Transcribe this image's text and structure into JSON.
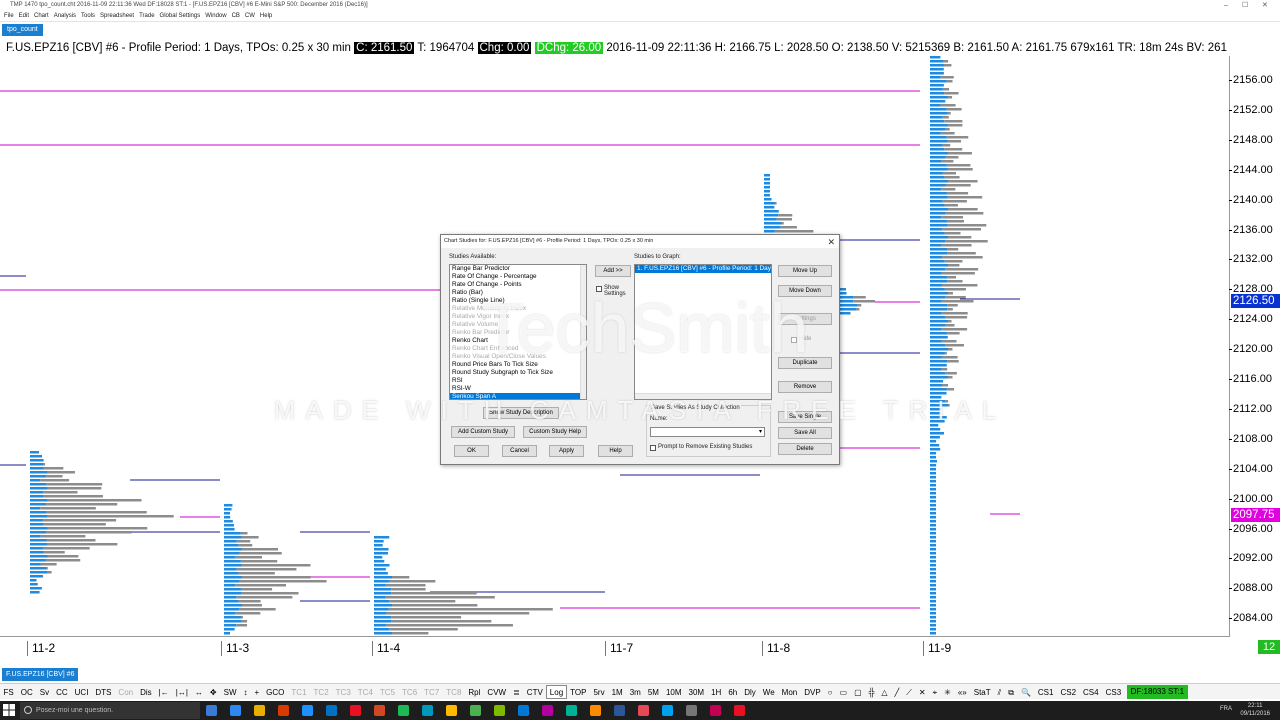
{
  "window": {
    "title": "TMP 1470 tpo_count.cht  2016-11-09  22:11:36 Wed  DF:18028  ST:1 - [F.US.EPZ16 [CBV] #6  E-Mini S&P 500: December 2016 (Dec16)]",
    "controls": [
      "–",
      "☐",
      "✕"
    ]
  },
  "menu": [
    "File",
    "Edit",
    "Chart",
    "Analysis",
    "Tools",
    "Spreadsheet",
    "Trade",
    "Global Settings",
    "Window",
    "CB",
    "CW",
    "Help"
  ],
  "chart_tab": "tpo_count",
  "header": {
    "symbol_text": "F.US.EPZ16 [CBV]  #6  - Profile Period: 1 Days, TPOs: 0.25 x 30 min",
    "close": "C: 2161.50",
    "ticks": " T: 1964704 ",
    "chg": "Chg: 0.00",
    "dchg": "DChg: 26.00",
    "rest": " 2016-11-09 22:11:36  H: 2166.75  L: 2028.50  O: 2138.50  V: 5215369  B: 2161.50  A: 2161.75  679x161  TR: 18m 24s  BV: 261"
  },
  "colors": {
    "tpo_blue": "#1e8ae0",
    "tpo_gray": "#8c8c8c",
    "level_magenta": "#d000d0",
    "level_navy": "#1a1a90",
    "price_label_blue": "#0a32d0",
    "price_label_magenta": "#e000e0"
  },
  "price_axis": {
    "ticks": [
      "2156.00",
      "2152.00",
      "2148.00",
      "2144.00",
      "2140.00",
      "2136.00",
      "2132.00",
      "2128.00",
      "2124.00",
      "2120.00",
      "2116.00",
      "2112.00",
      "2108.00",
      "2104.00",
      "2100.00",
      "2096.00",
      "2092.00",
      "2088.00",
      "2084.00"
    ],
    "current_label": "2126.50",
    "magenta_label": "2097.75"
  },
  "date_axis": [
    "11-2",
    "11-3",
    "11-4",
    "11-7",
    "11-8",
    "11-9"
  ],
  "corner_badge": "12",
  "sheet_tab": "F.US.EPZ16 [CBV]  #6",
  "toolbar": {
    "items": [
      "FS",
      "OC",
      "Sv",
      "CC",
      "UCI",
      "DTS",
      "Con",
      "Dis",
      "|←",
      "|↔|",
      "↔",
      "✥",
      "SW",
      "↕",
      "+",
      "GCO",
      "TC1",
      "TC2",
      "TC3",
      "TC4",
      "TC5",
      "TC6",
      "TC7",
      "TC8",
      "Rpl",
      "CVW",
      "≣",
      "CTV",
      "Log",
      "TOP",
      "5rv",
      "1M",
      "3m",
      "5M",
      "10M",
      "30M",
      "1H",
      "6h",
      "Dly",
      "We",
      "Mon",
      "DVP",
      "○",
      "▭",
      "▢",
      "╬",
      "△",
      "╱",
      "⟋",
      "✕",
      "⌖",
      "✳",
      "«»",
      "StaT",
      "⫽",
      "⧉",
      "🔍",
      "CS1",
      "CS2",
      "CS4",
      "CS3"
    ],
    "dim_items": [
      "Con",
      "TC1",
      "TC2",
      "TC3",
      "TC4",
      "TC5",
      "TC6",
      "TC7",
      "TC8"
    ],
    "status": "DF:18033  ST:1"
  },
  "taskbar": {
    "search_placeholder": "Posez-moi une question.",
    "language": "FRA",
    "time": "22:11",
    "date": "09/11/2016"
  },
  "dialog": {
    "title": "Chart Studies for: F.US.EPZ16 [CBV]  #6 - Profile Period: 1 Days, TPOs: 0.25 x 30 min",
    "available_label": "Studies Available:",
    "available": [
      {
        "name": "Range Bar Predictor",
        "state": "normal"
      },
      {
        "name": "Rate Of Change - Percentage",
        "state": "normal"
      },
      {
        "name": "Rate Of Change - Points",
        "state": "normal"
      },
      {
        "name": "Ratio (Bar)",
        "state": "normal"
      },
      {
        "name": "Ratio (Single Line)",
        "state": "normal"
      },
      {
        "name": "Relative Momentum Index",
        "state": "faded"
      },
      {
        "name": "Relative Vigor Index",
        "state": "faded"
      },
      {
        "name": "Relative Volume",
        "state": "faded"
      },
      {
        "name": "Renko Bar Predictor",
        "state": "faded"
      },
      {
        "name": "Renko Chart",
        "state": "normal"
      },
      {
        "name": "Renko Chart Enhanced",
        "state": "faded"
      },
      {
        "name": "Renko Visual Open/Close Values",
        "state": "faded"
      },
      {
        "name": "Round Price Bars To Tick Size",
        "state": "normal"
      },
      {
        "name": "Round Study Subgraph to Tick Size",
        "state": "normal"
      },
      {
        "name": "RSI",
        "state": "normal"
      },
      {
        "name": "RSI-W",
        "state": "normal"
      },
      {
        "name": "Senkou Span A",
        "state": "selected"
      }
    ],
    "add_button": "Add >>",
    "show_settings": "Show Settings",
    "graph_label": "Studies to Graph:",
    "graph": [
      "1. F.US.EPZ16 [CBV]  #6 - Profile Period: 1 Day"
    ],
    "move_up": "Move Up",
    "move_down": "Move Down",
    "settings": "Settings",
    "hide": "Hide",
    "duplicate": "Duplicate",
    "remove": "Remove",
    "show_description": "Show Study Description",
    "add_custom": "Add Custom Study",
    "custom_help": "Custom Study Help",
    "ok": "OK",
    "cancel": "Cancel",
    "apply": "Apply",
    "help": "Help",
    "save_collection_label": "Save Studies As Study Collection",
    "name_label": "Name:",
    "save_single": "Save Single",
    "save_all": "Save All",
    "prompt_remove": "Prompt to Remove Existing Studies",
    "delete": "Delete"
  },
  "watermark": {
    "brand": "TechSmith",
    "line2": "MADE WITH CAMTASIA FREE TRIAL"
  }
}
